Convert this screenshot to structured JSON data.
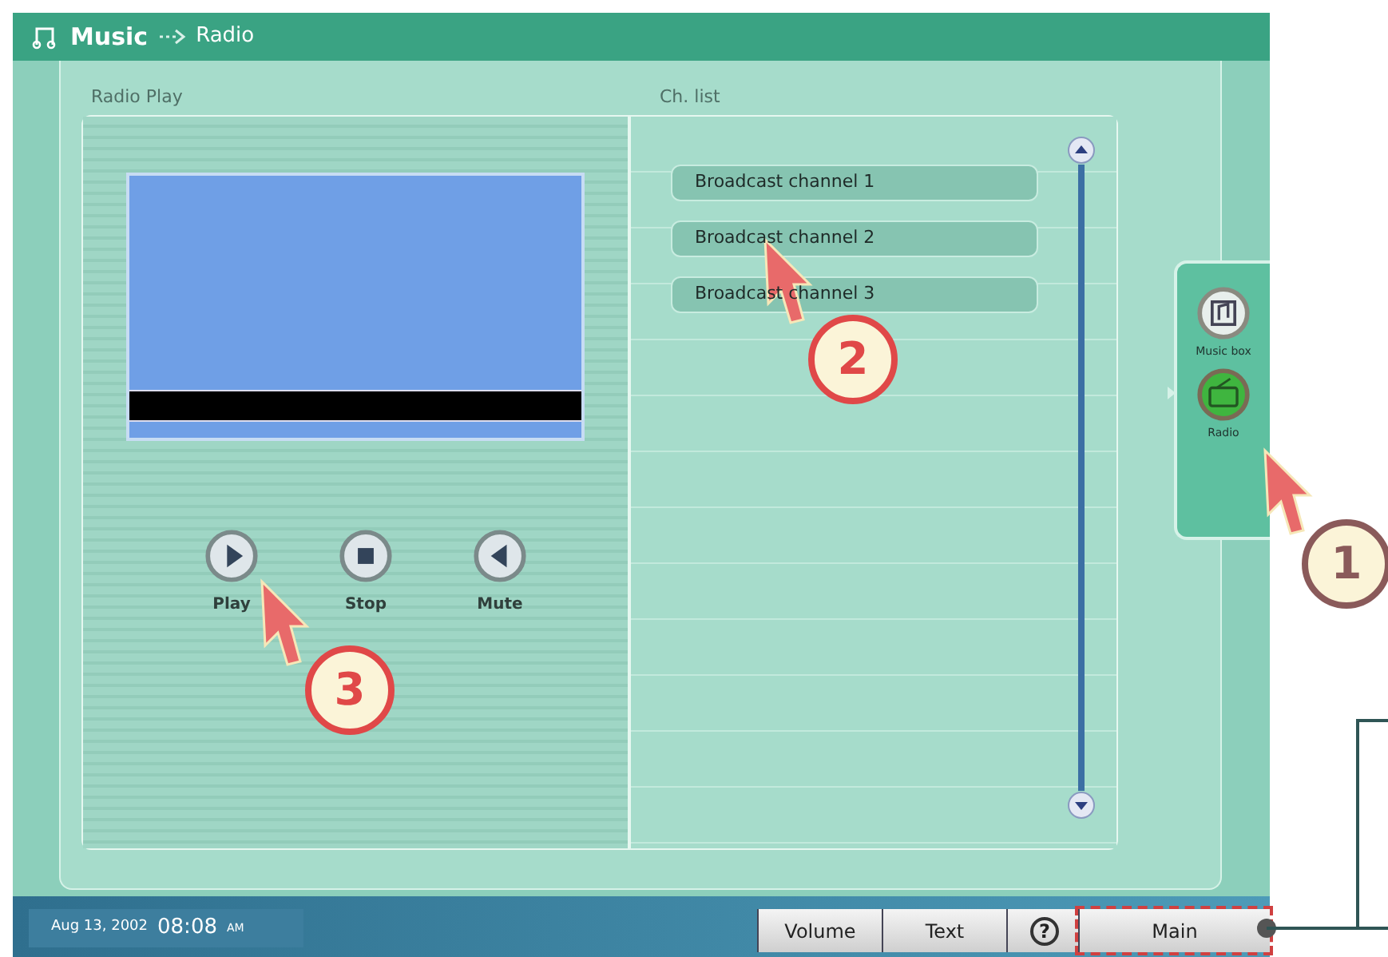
{
  "breadcrumb": {
    "section": "Music",
    "page": "Radio"
  },
  "radio_play": {
    "title": "Radio Play",
    "controls": [
      {
        "label": "Play",
        "kind": "play"
      },
      {
        "label": "Stop",
        "kind": "stop"
      },
      {
        "label": "Mute",
        "kind": "mute"
      }
    ]
  },
  "channel_list": {
    "title": "Ch. list",
    "channels": [
      {
        "name": "Broadcast channel 1",
        "selected": false
      },
      {
        "name": "Broadcast channel 2",
        "selected": false
      },
      {
        "name": "Broadcast channel 3",
        "selected": false
      }
    ]
  },
  "side_menu": [
    {
      "label": "Music box",
      "kind": "musicbox",
      "selected": false
    },
    {
      "label": "Radio",
      "kind": "radio",
      "selected": true
    }
  ],
  "status_bar": {
    "date": "Aug 13, 2002",
    "time": "08:08",
    "meridiem": "AM"
  },
  "buttons": [
    {
      "label": "Volume",
      "kind": "text",
      "highlighted": false
    },
    {
      "label": "Text",
      "kind": "text",
      "highlighted": false
    },
    {
      "label": "?",
      "kind": "circle",
      "highlighted": false
    },
    {
      "label": "Main",
      "kind": "text",
      "highlighted": true
    }
  ],
  "callouts": [
    "1",
    "2",
    "3"
  ]
}
